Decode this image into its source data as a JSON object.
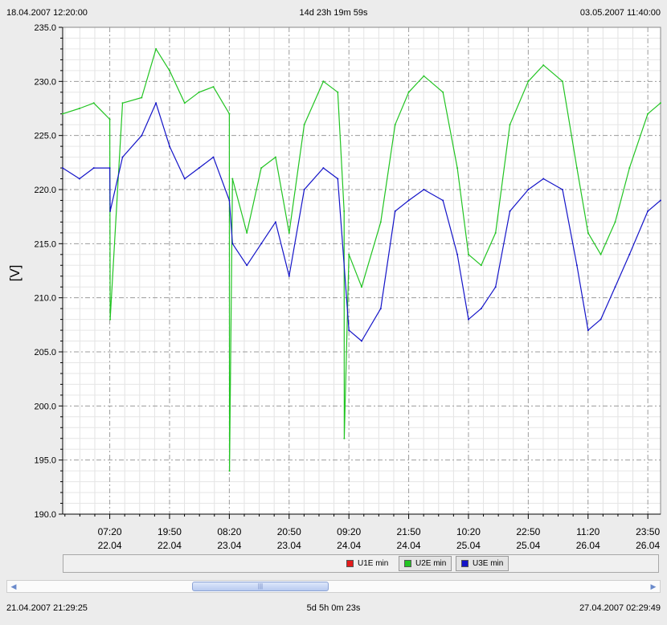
{
  "range": {
    "start": "18.04.2007 12:20:00",
    "duration": "14d 23h 19m 59s",
    "end": "03.05.2007 11:40:00"
  },
  "view": {
    "start": "21.04.2007 21:29:25",
    "duration": "5d 5h 0m 23s",
    "end": "27.04.2007 02:29:49"
  },
  "legend": [
    {
      "label": "U1E min",
      "color": "#e31b1b"
    },
    {
      "label": "U2E min",
      "color": "#22c422"
    },
    {
      "label": "U3E min",
      "color": "#1414c8"
    }
  ],
  "scrollbar": {
    "left_icon": "chevron-left-icon",
    "right_icon": "chevron-right-icon",
    "thumb_grip": "|||"
  },
  "chart_data": {
    "type": "line",
    "ylabel": "[V]",
    "ylim": [
      190.0,
      235.0
    ],
    "yticks": [
      "190.0",
      "195.0",
      "200.0",
      "205.0",
      "210.0",
      "215.0",
      "220.0",
      "225.0",
      "230.0",
      "235.0"
    ],
    "xticks": [
      {
        "time": "07:20",
        "date": "22.04"
      },
      {
        "time": "19:50",
        "date": "22.04"
      },
      {
        "time": "08:20",
        "date": "23.04"
      },
      {
        "time": "20:50",
        "date": "23.04"
      },
      {
        "time": "09:20",
        "date": "24.04"
      },
      {
        "time": "21:50",
        "date": "24.04"
      },
      {
        "time": "10:20",
        "date": "25.04"
      },
      {
        "time": "22:50",
        "date": "25.04"
      },
      {
        "time": "11:20",
        "date": "26.04"
      },
      {
        "time": "23:50",
        "date": "26.04"
      }
    ],
    "series": [
      {
        "name": "U2E min",
        "color": "#22c422",
        "x": [
          "2007-04-21 21:29",
          "2007-04-22 01:00",
          "2007-04-22 04:00",
          "2007-04-22 07:20",
          "2007-04-22 07:25",
          "2007-04-22 10:00",
          "2007-04-22 14:00",
          "2007-04-22 17:00",
          "2007-04-22 19:50",
          "2007-04-22 23:00",
          "2007-04-23 02:00",
          "2007-04-23 05:00",
          "2007-04-23 08:20",
          "2007-04-23 08:22",
          "2007-04-23 09:00",
          "2007-04-23 12:00",
          "2007-04-23 15:00",
          "2007-04-23 18:00",
          "2007-04-23 20:50",
          "2007-04-24 00:00",
          "2007-04-24 04:00",
          "2007-04-24 07:00",
          "2007-04-24 08:20",
          "2007-04-24 08:22",
          "2007-04-24 09:20",
          "2007-04-24 12:00",
          "2007-04-24 16:00",
          "2007-04-24 19:00",
          "2007-04-24 21:50",
          "2007-04-25 01:00",
          "2007-04-25 05:00",
          "2007-04-25 08:00",
          "2007-04-25 10:20",
          "2007-04-25 13:00",
          "2007-04-25 16:00",
          "2007-04-25 19:00",
          "2007-04-25 22:50",
          "2007-04-26 02:00",
          "2007-04-26 06:00",
          "2007-04-26 09:00",
          "2007-04-26 11:20",
          "2007-04-26 14:00",
          "2007-04-26 17:00",
          "2007-04-26 20:00",
          "2007-04-26 23:50",
          "2007-04-27 02:29"
        ],
        "y": [
          227.0,
          227.5,
          228.0,
          226.5,
          208.0,
          228.0,
          228.5,
          233.0,
          231.0,
          228.0,
          229.0,
          229.5,
          227.0,
          194.0,
          221.0,
          216.0,
          222.0,
          223.0,
          216.0,
          226.0,
          230.0,
          229.0,
          218.0,
          197.0,
          214.0,
          211.0,
          217.0,
          226.0,
          229.0,
          230.5,
          229.0,
          222.0,
          214.0,
          213.0,
          216.0,
          226.0,
          230.0,
          231.5,
          230.0,
          222.0,
          216.0,
          214.0,
          217.0,
          222.0,
          227.0,
          228.0
        ]
      },
      {
        "name": "U3E min",
        "color": "#1414c8",
        "x": [
          "2007-04-21 21:29",
          "2007-04-22 01:00",
          "2007-04-22 04:00",
          "2007-04-22 07:20",
          "2007-04-22 07:25",
          "2007-04-22 10:00",
          "2007-04-22 14:00",
          "2007-04-22 17:00",
          "2007-04-22 19:50",
          "2007-04-22 23:00",
          "2007-04-23 02:00",
          "2007-04-23 05:00",
          "2007-04-23 08:20",
          "2007-04-23 09:00",
          "2007-04-23 12:00",
          "2007-04-23 15:00",
          "2007-04-23 18:00",
          "2007-04-23 20:50",
          "2007-04-24 00:00",
          "2007-04-24 04:00",
          "2007-04-24 07:00",
          "2007-04-24 09:20",
          "2007-04-24 12:00",
          "2007-04-24 16:00",
          "2007-04-24 19:00",
          "2007-04-24 21:50",
          "2007-04-25 01:00",
          "2007-04-25 05:00",
          "2007-04-25 08:00",
          "2007-04-25 10:20",
          "2007-04-25 13:00",
          "2007-04-25 16:00",
          "2007-04-25 19:00",
          "2007-04-25 22:50",
          "2007-04-26 02:00",
          "2007-04-26 06:00",
          "2007-04-26 09:00",
          "2007-04-26 11:20",
          "2007-04-26 14:00",
          "2007-04-26 17:00",
          "2007-04-26 20:00",
          "2007-04-26 23:50",
          "2007-04-27 02:29"
        ],
        "y": [
          222.0,
          221.0,
          222.0,
          222.0,
          218.0,
          223.0,
          225.0,
          228.0,
          224.0,
          221.0,
          222.0,
          223.0,
          219.0,
          215.0,
          213.0,
          215.0,
          217.0,
          212.0,
          220.0,
          222.0,
          221.0,
          207.0,
          206.0,
          209.0,
          218.0,
          219.0,
          220.0,
          219.0,
          214.0,
          208.0,
          209.0,
          211.0,
          218.0,
          220.0,
          221.0,
          220.0,
          213.0,
          207.0,
          208.0,
          211.0,
          214.0,
          218.0,
          219.0
        ]
      }
    ]
  }
}
